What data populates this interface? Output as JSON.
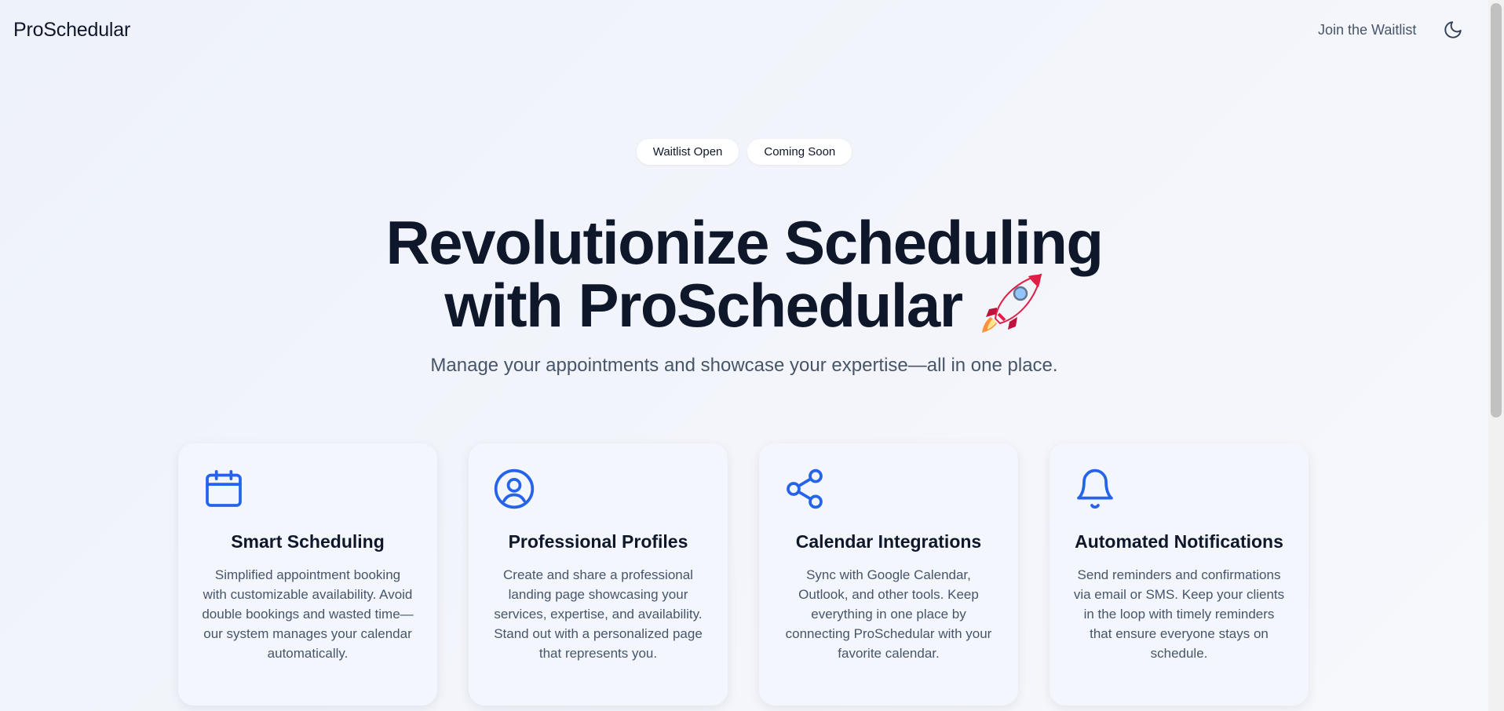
{
  "navbar": {
    "brand": "ProSchedular",
    "cta_label": "Join the Waitlist",
    "theme_toggle_icon": "moon-icon"
  },
  "badges": [
    "Waitlist Open",
    "Coming Soon"
  ],
  "hero": {
    "title_line1": "Revolutionize Scheduling",
    "title_line2": "with ProSchedular",
    "title_emoji_icon": "rocket-icon",
    "subtitle": "Manage your appointments and showcase your expertise—all in one place."
  },
  "features": [
    {
      "icon": "calendar-icon",
      "title": "Smart Scheduling",
      "description": "Simplified appointment booking with customizable availability. Avoid double bookings and wasted time—our system manages your calendar automatically."
    },
    {
      "icon": "user-circle-icon",
      "title": "Professional Profiles",
      "description": "Create and share a professional landing page showcasing your services, expertise, and availability. Stand out with a personalized page that represents you."
    },
    {
      "icon": "share-icon",
      "title": "Calendar Integrations",
      "description": "Sync with Google Calendar, Outlook, and other tools. Keep everything in one place by connecting ProSchedular with your favorite calendar."
    },
    {
      "icon": "bell-icon",
      "title": "Automated Notifications",
      "description": "Send reminders and confirmations via email or SMS. Keep your clients in the loop with timely reminders that ensure everyone stays on schedule."
    }
  ],
  "colors": {
    "accent": "#2563eb",
    "heading": "#0f172a",
    "body_text": "#475569",
    "background": "#eef2fa",
    "card_background": "#f3f6fd"
  }
}
